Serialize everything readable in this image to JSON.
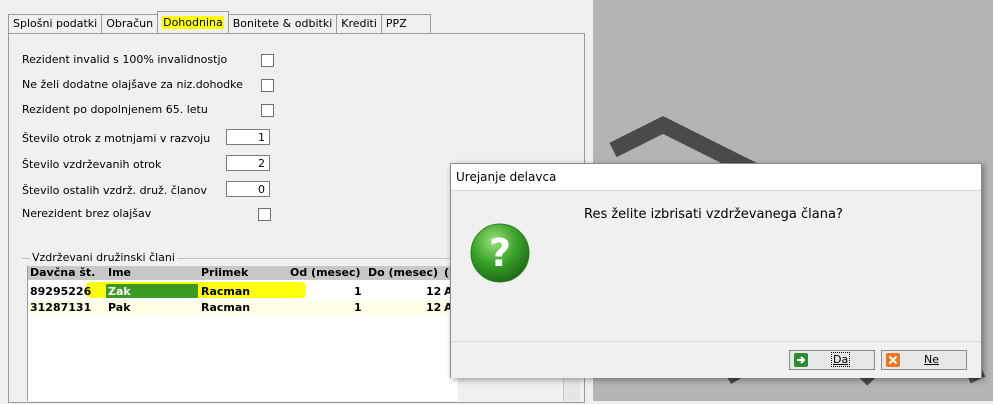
{
  "tabs": [
    {
      "label": "Splošni podatki"
    },
    {
      "label": "Obračun"
    },
    {
      "label": "Dohodnina"
    },
    {
      "label": "Bonitete & odbitki"
    },
    {
      "label": "Krediti"
    },
    {
      "label": "PPZ"
    }
  ],
  "active_tab": "Dohodnina",
  "form": {
    "invalid_label": "Rezident invalid s 100% invalidnostjo",
    "no_relief_label": "Ne želi dodatne olajšave za niz.dohodke",
    "over65_label": "Rezident po dopolnjenem 65. letu",
    "disabled_children_label": "Število otrok z motnjami v razvoju",
    "disabled_children_value": "1",
    "children_label": "Število vzdrževanih otrok",
    "children_value": "2",
    "other_members_label": "Število ostalih vzdrž. druž. članov",
    "other_members_value": "0",
    "nonresident_label": "Nerezident brez olajšav"
  },
  "members": {
    "group_label": "Vzdrževani družinski člani",
    "columns": [
      "Davčna št.",
      "Ime",
      "Priimek",
      "Od (mesec)",
      "Do (mesec)",
      "("
    ],
    "rows": [
      {
        "tax": "89295226",
        "name": "Zak",
        "surname": "Racman",
        "from": "1",
        "to": "12",
        "extra": "A"
      },
      {
        "tax": "31287131",
        "name": "Pak",
        "surname": "Racman",
        "from": "1",
        "to": "12",
        "extra": "A"
      }
    ]
  },
  "dialog": {
    "title": "Urejanje delavca",
    "message": "Res želite izbrisati vzdrževanega člana?",
    "yes_label": "Da",
    "no_label": "Ne",
    "icon": "question-icon"
  }
}
